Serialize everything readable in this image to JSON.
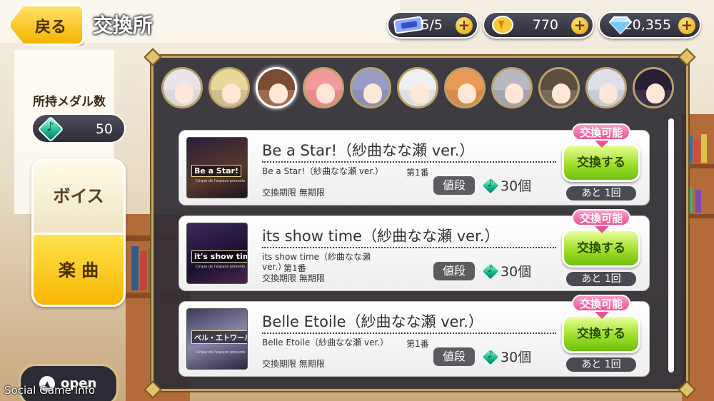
{
  "header": {
    "back_label": "戻る",
    "title": "交換所",
    "resources": [
      {
        "icon": "ticket-icon",
        "value": "5/5"
      },
      {
        "icon": "coin-icon",
        "value": "770"
      },
      {
        "icon": "diamond-icon",
        "value": "20,355"
      }
    ]
  },
  "sidebar": {
    "medal_label": "所持メダル数",
    "medal_count": "50",
    "categories": [
      {
        "label": "ボイス",
        "selected": false
      },
      {
        "label": "楽 曲",
        "selected": true
      }
    ],
    "open_label": "open",
    "open_icon": "triangle-up-icon"
  },
  "characters": {
    "count": 11,
    "selected_index": 2
  },
  "items": [
    {
      "title": "Be a Star!（紗曲なな瀬 ver.）",
      "detail": "Be a Star!（紗曲なな瀬 ver.）",
      "number": "第1番",
      "limit": "交換期限 無期限",
      "price_label": "値段",
      "price": "30個",
      "badge": "交換可能",
      "button": "交換する",
      "remaining": "あと 1回",
      "thumb_title": "Be a Star!",
      "thumb_sub": "Cirque de l'espace presents"
    },
    {
      "title": "its show time（紗曲なな瀬 ver.）",
      "detail": "its show time（紗曲なな瀬 ver.）",
      "number": "第1番",
      "limit": "交換期限 無期限",
      "price_label": "値段",
      "price": "30個",
      "badge": "交換可能",
      "button": "交換する",
      "remaining": "あと 1回",
      "thumb_title": "it's show time",
      "thumb_sub": "Cirque de l'espace presents"
    },
    {
      "title": "Belle Etoile（紗曲なな瀬 ver.）",
      "detail": "Belle Etoile（紗曲なな瀬 ver.）",
      "number": "第1番",
      "limit": "交換期限 無期限",
      "price_label": "値段",
      "price": "30個",
      "badge": "交換可能",
      "button": "交換する",
      "remaining": "あと 1回",
      "thumb_title": "ベル・エトワール",
      "thumb_sub": "Cirque de l'espace presents"
    }
  ],
  "watermark": "Social Game Info",
  "colors": {
    "accent_yellow": "#f5b400",
    "button_green": "#9ee02a",
    "badge_pink": "#e85596",
    "medal_teal": "#17b38a",
    "panel_dark": "#302e36",
    "frame_gold": "#c8a65a"
  }
}
